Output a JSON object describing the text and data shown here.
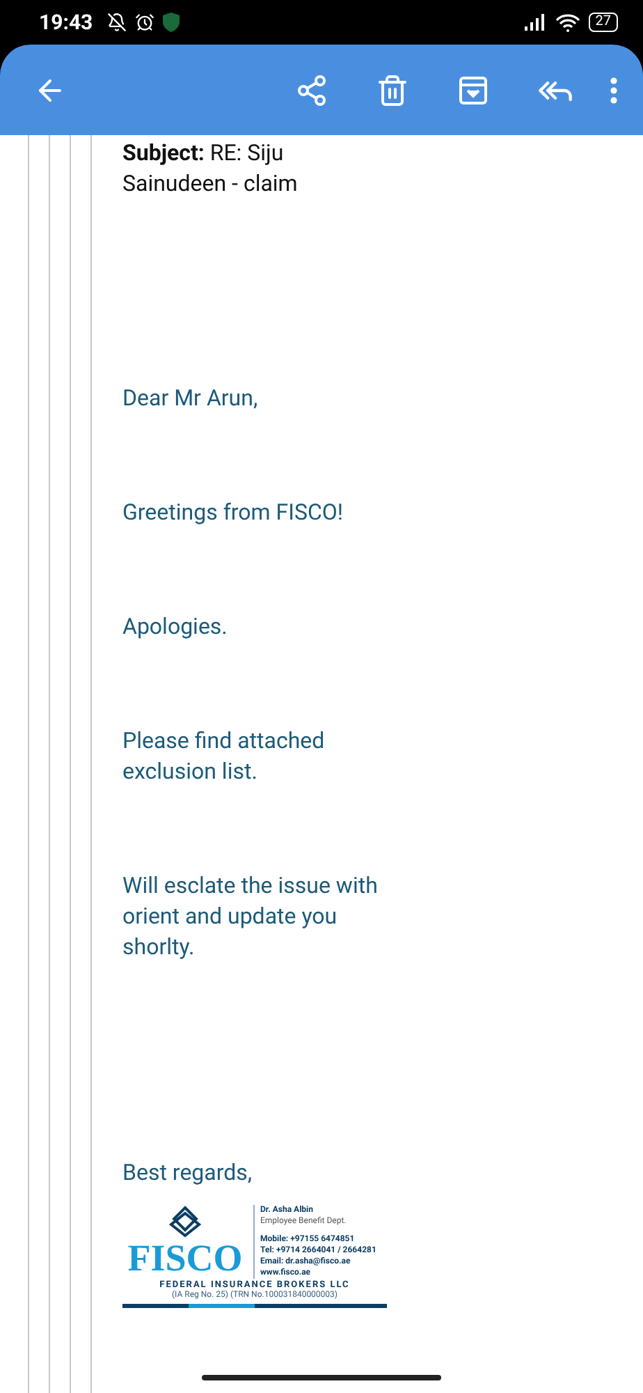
{
  "status_bar": {
    "time": "19:43",
    "battery": "27"
  },
  "email": {
    "subject": "**Subject:** RE: Siju Sainudeen - claim",
    "paragraphs": [
      "Dear Mr Arun,",
      "Greetings from FISCO!",
      "Apologies.",
      "Please find attached exclusion list.",
      "Will esclate the issue with orient and update you shorlty.",
      "Best regards,"
    ],
    "signature": {
      "brand": "FISCO",
      "name": "Dr. Asha Albin",
      "department": "Employee Benefit Dept.",
      "contacts": [
        "Mobile: +97155 6474851",
        "Tel: +9714 2664041 / 2664281",
        "Email: dr.asha@fisco.ae",
        "www.fisco.ae"
      ],
      "company": "FEDERAL INSURANCE BROKERS LLC",
      "registration": "(IA Reg No. 25) (TRN No.100031840000003)"
    }
  }
}
